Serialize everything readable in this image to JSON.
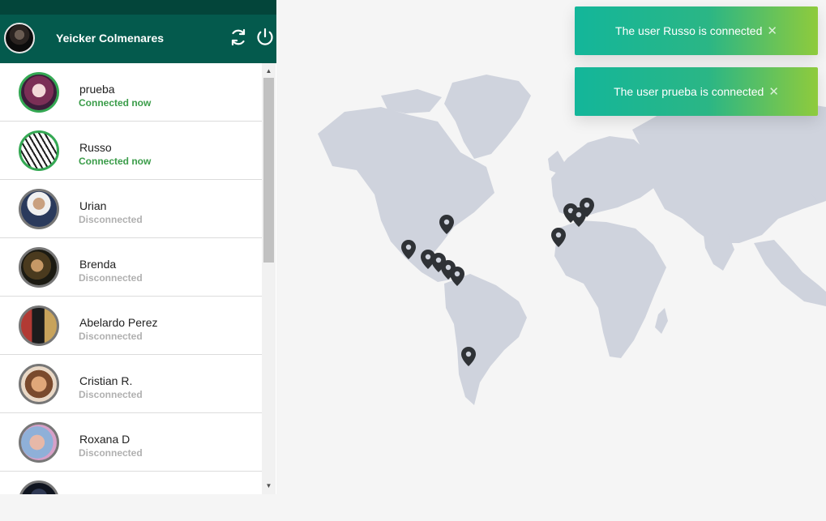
{
  "user": {
    "name": "Yeicker Colmenares"
  },
  "header_icons": [
    "refresh-icon",
    "power-icon"
  ],
  "contacts": [
    {
      "name": "prueba",
      "status": "Connected now",
      "online": true
    },
    {
      "name": "Russo",
      "status": "Connected now",
      "online": true
    },
    {
      "name": "Urian",
      "status": "Disconnected",
      "online": false
    },
    {
      "name": "Brenda",
      "status": "Disconnected",
      "online": false
    },
    {
      "name": "Abelardo Perez",
      "status": "Disconnected",
      "online": false
    },
    {
      "name": "Cristian R.",
      "status": "Disconnected",
      "online": false
    },
    {
      "name": "Roxana D",
      "status": "Disconnected",
      "online": false
    }
  ],
  "notifications": [
    {
      "text": "The user Russo is connected",
      "close": "✕"
    },
    {
      "text": "The user prueba is connected",
      "close": "✕"
    }
  ],
  "scrollbar": {
    "up": "▲",
    "down": "▼"
  },
  "colors": {
    "header": "#045a4d",
    "online_border": "#34a853",
    "online_text": "#3a9c49",
    "offline_text": "#b0b0b0",
    "map_land": "#cfd3dd",
    "marker": "#2f3236",
    "toast_start": "#13b69a",
    "toast_end": "#8fcb3c"
  }
}
